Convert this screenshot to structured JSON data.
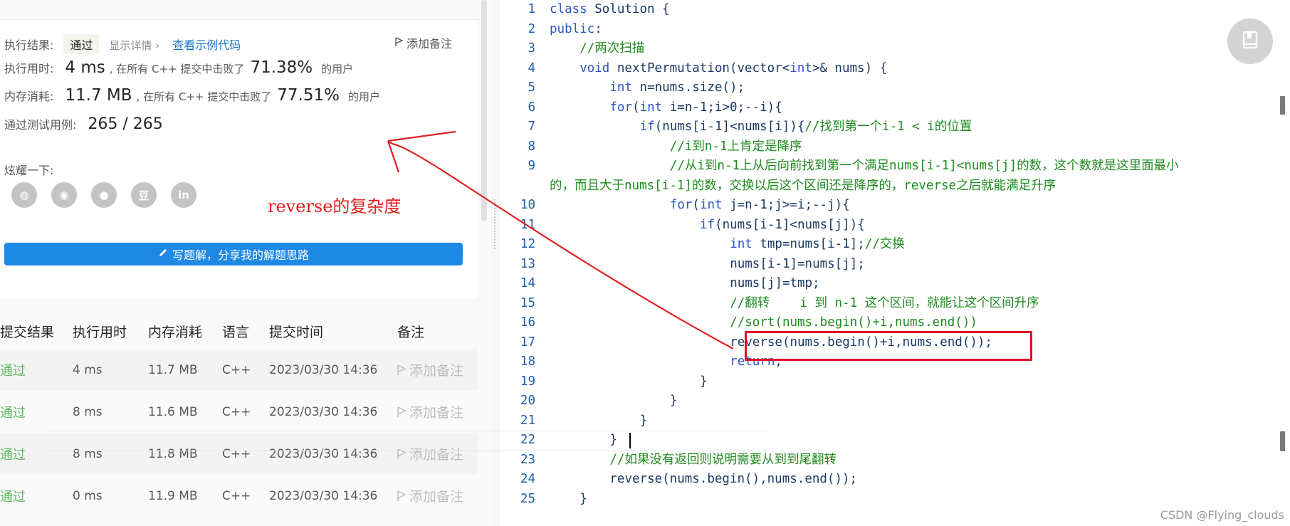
{
  "result_card": {
    "result_label": "执行结果:",
    "result_badge": "通过",
    "show_detail": "显示详情 ›",
    "example_code": "查看示例代码",
    "add_note": "添加备注",
    "runtime_label": "执行用时:",
    "runtime_value": "4 ms",
    "runtime_mid": ", 在所有 C++ 提交中击败了",
    "runtime_pct": "71.38%",
    "runtime_users": "的用户",
    "memory_label": "内存消耗:",
    "memory_value": "11.7 MB",
    "memory_mid": ", 在所有 C++ 提交中击败了",
    "memory_pct": "77.51%",
    "memory_users": "的用户",
    "tests_label": "通过测试用例:",
    "tests_value": "265 / 265",
    "share_label": "炫耀一下:",
    "share_icons": [
      {
        "name": "wechat-icon",
        "glyph": "◍"
      },
      {
        "name": "weibo-icon",
        "glyph": "◉"
      },
      {
        "name": "qq-icon",
        "glyph": "●"
      },
      {
        "name": "douban-icon",
        "glyph": "豆"
      },
      {
        "name": "linkedin-icon",
        "glyph": "in"
      }
    ],
    "solution_button": "写题解，分享我的解题思路"
  },
  "submissions": {
    "headers": [
      "提交结果",
      "执行用时",
      "内存消耗",
      "语言",
      "提交时间",
      "备注"
    ],
    "rows": [
      {
        "result": "通过",
        "time": "4 ms",
        "memory": "11.7 MB",
        "lang": "C++",
        "date": "2023/03/30 14:36",
        "note": "添加备注"
      },
      {
        "result": "通过",
        "time": "8 ms",
        "memory": "11.6 MB",
        "lang": "C++",
        "date": "2023/03/30 14:36",
        "note": "添加备注"
      },
      {
        "result": "通过",
        "time": "8 ms",
        "memory": "11.8 MB",
        "lang": "C++",
        "date": "2023/03/30 14:36",
        "note": "添加备注"
      },
      {
        "result": "通过",
        "time": "0 ms",
        "memory": "11.9 MB",
        "lang": "C++",
        "date": "2023/03/30 14:36",
        "note": "添加备注"
      }
    ]
  },
  "annotation": {
    "text": "reverse的复杂度",
    "color": "#e02020"
  },
  "code": {
    "lines": [
      {
        "n": "1",
        "indent": 0,
        "html": "<span class=\"kw\">class</span> Solution {"
      },
      {
        "n": "2",
        "indent": 0,
        "html": "<span class=\"kw\">public</span>:"
      },
      {
        "n": "3",
        "indent": 4,
        "html": "<span class=\"cm\">//两次扫描</span>"
      },
      {
        "n": "4",
        "indent": 4,
        "html": "<span class=\"kw\">void</span> nextPermutation(vector&lt;<span class=\"kw\">int</span>&gt;&amp; nums) {"
      },
      {
        "n": "5",
        "indent": 8,
        "html": "<span class=\"kw\">int</span> n=nums.size();"
      },
      {
        "n": "6",
        "indent": 8,
        "html": "<span class=\"kw\">for</span>(<span class=\"kw\">int</span> i=n-1;i&gt;0;--i){"
      },
      {
        "n": "7",
        "indent": 12,
        "html": "<span class=\"kw\">if</span>(nums[i-1]&lt;nums[i]){<span class=\"cm\">//找到第一个i-1 &lt; i的位置</span>"
      },
      {
        "n": "8",
        "indent": 16,
        "html": "<span class=\"cm\">//i到n-1上肯定是降序</span>"
      },
      {
        "n": "9",
        "indent": 16,
        "wrap": true,
        "html": "<span class=\"cm\">//从i到n-1上从后向前找到第一个满足nums[i-1]&lt;nums[j]的数，这个数就是这里面最小</span>",
        "html2": "<span class=\"cm\">的，而且大于nums[i-1]的数，交换以后这个区间还是降序的，reverse之后就能满足升序</span>"
      },
      {
        "n": "10",
        "indent": 16,
        "html": "<span class=\"kw\">for</span>(<span class=\"kw\">int</span> j=n-1;j&gt;=i;--j){"
      },
      {
        "n": "11",
        "indent": 20,
        "html": "<span class=\"kw\">if</span>(nums[i-1]&lt;nums[j]){"
      },
      {
        "n": "12",
        "indent": 24,
        "html": "<span class=\"kw\">int</span> tmp=nums[i-1];<span class=\"cm\">//交换</span>"
      },
      {
        "n": "13",
        "indent": 24,
        "html": "nums[i-1]=nums[j];"
      },
      {
        "n": "14",
        "indent": 24,
        "html": "nums[j]=tmp;"
      },
      {
        "n": "15",
        "indent": 24,
        "html": "<span class=\"cm\">//翻转    i 到 n-1 这个区间，就能让这个区间升序</span>"
      },
      {
        "n": "16",
        "indent": 24,
        "html": "<span class=\"cm\">//sort(nums.begin()+i,nums.end())</span>"
      },
      {
        "n": "17",
        "indent": 24,
        "html": "reverse(nums.begin()+i,nums.end());"
      },
      {
        "n": "18",
        "indent": 24,
        "html": "<span class=\"kw\">return</span>;"
      },
      {
        "n": "19",
        "indent": 20,
        "html": "}"
      },
      {
        "n": "20",
        "indent": 16,
        "html": "}"
      },
      {
        "n": "21",
        "indent": 12,
        "html": "}"
      },
      {
        "n": "22",
        "indent": 8,
        "html": "}"
      },
      {
        "n": "23",
        "indent": 8,
        "html": "<span class=\"cm\">//如果没有返回则说明需要从到到尾翻转</span>"
      },
      {
        "n": "24",
        "indent": 8,
        "html": "reverse(nums.begin(),nums.end());"
      },
      {
        "n": "25",
        "indent": 4,
        "html": "}"
      }
    ]
  },
  "watermark": "CSDN @Flying_clouds"
}
